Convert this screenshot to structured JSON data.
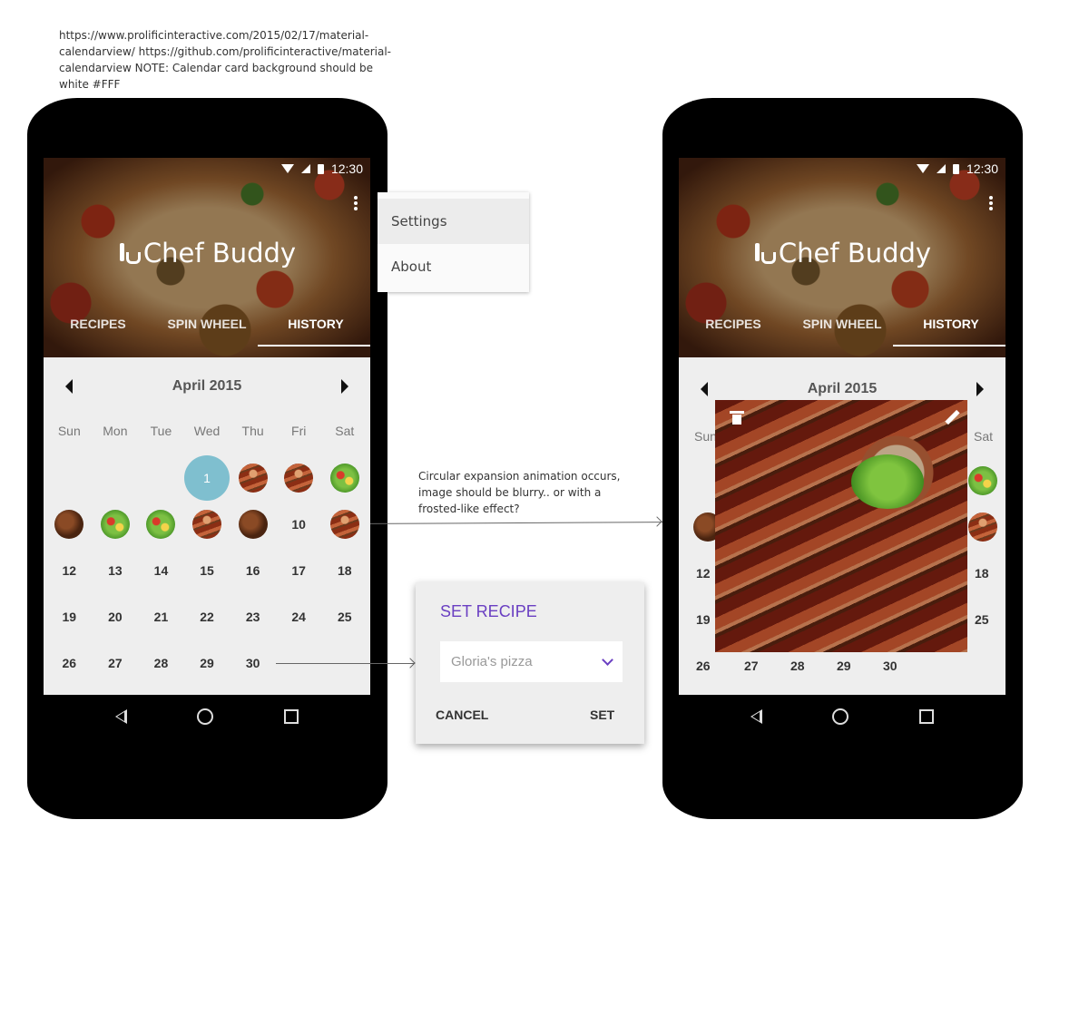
{
  "note_top": "https://www.prolificinteractive.com/2015/02/17/material-calendarview/ https://github.com/prolificinteractive/material-calendarview NOTE: Calendar card background should be white #FFF",
  "note_mid": "Circular expansion animation occurs, image should be blurry.. or with a frosted-like effect?",
  "status_time": "12:30",
  "app_title": "Chef Buddy",
  "tabs": [
    "RECIPES",
    "SPIN WHEEL",
    "HISTORY"
  ],
  "month": "April 2015",
  "weekdays": [
    "Sun",
    "Mon",
    "Tue",
    "Wed",
    "Thu",
    "Fri",
    "Sat"
  ],
  "weeks_phone1": [
    [
      "",
      "",
      "",
      "1",
      "sausage",
      "sausage",
      "salad"
    ],
    [
      "steak",
      "salad",
      "salad",
      "sausage",
      "steak",
      "10",
      "sausage"
    ],
    [
      "12",
      "13",
      "14",
      "15",
      "16",
      "17",
      "18"
    ],
    [
      "19",
      "20",
      "21",
      "22",
      "23",
      "24",
      "25"
    ],
    [
      "26",
      "27",
      "28",
      "29",
      "30",
      "",
      ""
    ]
  ],
  "menu": [
    "Settings",
    "About"
  ],
  "dialog": {
    "title": "SET RECIPE",
    "selected": "Gloria's pizza",
    "cancel": "CANCEL",
    "set": "SET"
  },
  "phone2": {
    "sun_partial": "Sun",
    "sat": "Sat",
    "left_col": [
      "12",
      "19",
      "26"
    ],
    "right_col": [
      "18",
      "25"
    ],
    "bottom_row": [
      "27",
      "28",
      "29",
      "30"
    ]
  },
  "colors": {
    "accent": "#6a3fc2",
    "today": "#7fbfcf",
    "calendar_bg": "#eeeeee"
  }
}
